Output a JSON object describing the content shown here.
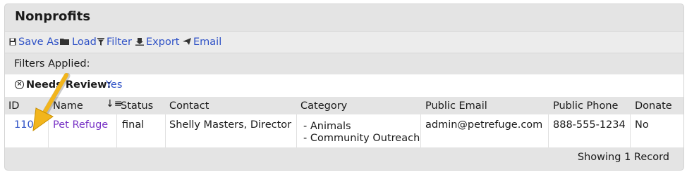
{
  "title": "Nonprofits",
  "toolbar": {
    "save_as": "Save As",
    "load": "Load",
    "filter": "Filter",
    "export": "Export",
    "email": "Email"
  },
  "filters": {
    "label": "Filters Applied:",
    "applied": [
      {
        "name": "Needs Review:",
        "value": "Yes"
      }
    ]
  },
  "table": {
    "columns": [
      "ID",
      "Name",
      "Status",
      "Contact",
      "Category",
      "Public Email",
      "Public Phone",
      "Donate"
    ],
    "sort_icon": "sort-descending-icon",
    "rows": [
      {
        "id": "1100",
        "name": "Pet Refuge",
        "status": "final",
        "contact": "Shelly Masters, Director",
        "categories": [
          "- Animals",
          "- Community Outreach"
        ],
        "public_email": "admin@petrefuge.com",
        "public_phone": "888-555-1234",
        "donate": "No"
      }
    ]
  },
  "footer": {
    "status": "Showing 1 Record"
  },
  "colors": {
    "link": "#2e51c6",
    "visited_link": "#7a35c6",
    "arrow": "#f2b51c",
    "panel": "#e4e4e4"
  }
}
